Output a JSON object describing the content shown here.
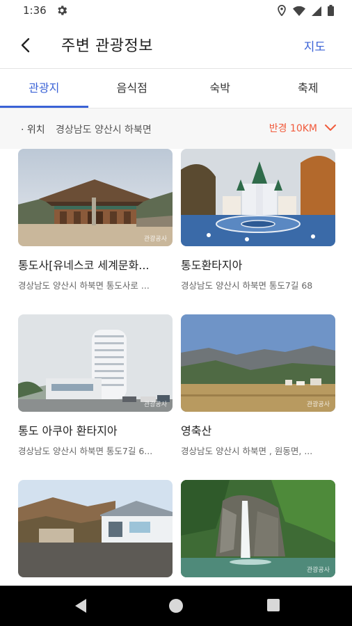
{
  "status_bar": {
    "time": "1:36",
    "icons": [
      "gear-icon",
      "location-icon",
      "wifi-icon",
      "signal-icon",
      "battery-icon"
    ]
  },
  "header": {
    "title": "주변 관광정보",
    "map_label": "지도",
    "back_icon": "chevron-left-icon"
  },
  "tabs": [
    {
      "label": "관광지",
      "active": true
    },
    {
      "label": "음식점",
      "active": false
    },
    {
      "label": "숙박",
      "active": false
    },
    {
      "label": "축제",
      "active": false
    }
  ],
  "filter": {
    "location_label": "· 위치",
    "location_value": "경상남도 양산시 하북면",
    "radius_label": "반경 10KM",
    "dropdown_icon": "chevron-down-icon"
  },
  "colors": {
    "accent": "#3a62d6",
    "radius": "#f15a3b",
    "filter_bg": "#f7f7f7"
  },
  "items": [
    {
      "title": "통도사[유네스코 세계문화...",
      "address": "경상남도 양산시 하북면 통도사로 ..."
    },
    {
      "title": "통도환타지아",
      "address": "경상남도 양산시 하북면 통도7길 68"
    },
    {
      "title": "통도 아쿠아 환타지아",
      "address": "경상남도 양산시 하북면 통도7길 6..."
    },
    {
      "title": "영축산",
      "address": "경상남도 양산시 하북면 , 원동면, ..."
    },
    {
      "title": "",
      "address": ""
    },
    {
      "title": "",
      "address": ""
    }
  ],
  "nav": [
    "back-triangle-icon",
    "home-circle-icon",
    "recents-square-icon"
  ]
}
